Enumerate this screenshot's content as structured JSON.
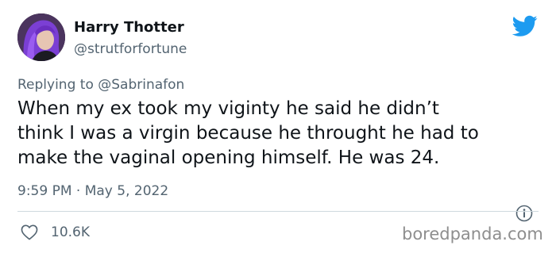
{
  "author": {
    "display_name": "Harry Thotter",
    "handle": "@strutforfortune",
    "avatar_icon": "profile-avatar"
  },
  "platform_icon": "twitter-bird-icon",
  "reply_context": {
    "prefix": "Replying to",
    "mention": "@Sabrinafon"
  },
  "tweet": {
    "lines": [
      "When my ex took my viginty he said he didn’t",
      "think I was a virgin because he throught he had to",
      "make the vaginal opening himself. He was 24."
    ],
    "timestamp": "9:59 PM · May 5, 2022"
  },
  "actions": {
    "like_count": "10.6K",
    "like_icon": "heart-icon",
    "info_icon": "info-icon"
  },
  "watermark": "boredpanda.com",
  "colors": {
    "twitter_blue": "#1d9bf0",
    "secondary_text": "#536471",
    "primary_text": "#0f1419",
    "divider": "#cfd9de",
    "watermark": "#8e8e8e"
  }
}
